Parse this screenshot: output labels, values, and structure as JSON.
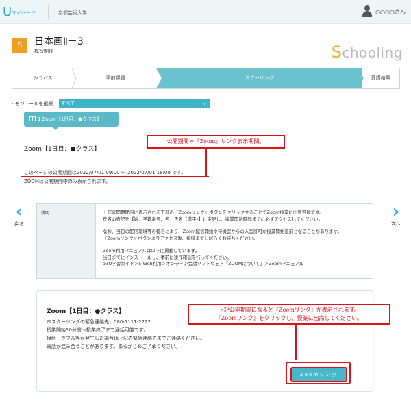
{
  "topbar": {
    "logo": "U",
    "mypage": "マイページ",
    "university": "京都芸術大学",
    "user_name": "○○○○さん"
  },
  "course": {
    "badge": "S",
    "title": "日本画Ⅱ－3",
    "subtitle": "模写制作",
    "brand_initial": "S",
    "brand_rest": "chooling"
  },
  "tabs": [
    {
      "label": "シラバス"
    },
    {
      "label": "事前課題"
    },
    {
      "label": "スクーリング"
    },
    {
      "label": "受講結果"
    }
  ],
  "module": {
    "label": "- モジュールを選択",
    "selected": "すべて"
  },
  "zoom_tab": {
    "label": "1 Zoom【1日目：●クラス】"
  },
  "section": {
    "title": "Zoom【1日目：●クラス】",
    "period": "このページの公開期間は2022/07/01 09:00 ～ 2022/07/01 18:00 です。",
    "period_note": "ZOOMは公開期間中のみ表示されます。"
  },
  "callouts": {
    "period": "公開期間＝『Zoom』リンク表示期間。",
    "zoom_line1": "上記公開期間になると『Zoomリンク』が表示されます。",
    "zoom_line2": "『Zoomリンク』をクリックし、授業に出席してください。"
  },
  "nav": {
    "prev": "戻る",
    "next": "次へ"
  },
  "description": {
    "head": "説明",
    "p1_l1": "上記公開期間内に表示される下部の『Zoomリンク』ボタンをクリックすることでZoom授業に出席可能です。",
    "p1_l2": "氏名の表記を【姓：学籍番号、名：氏名（漢字）】に変更し、授業開始時間までに必ずアクセスしてください。",
    "p2_l1": "なお、当日の配信環境等の都合により、Zoom配信開始や待機室からの入室許可が授業開始直前となることがあります。",
    "p2_l2": "『Zoomリンク』ボタンよりアクセス後、接続までしばらくお待ちください。",
    "p3_l1": "Zoom利用マニュアルは以下に掲載しています。",
    "p3_l2": "当日までにインストールし、事前に操作確認を行ってください。",
    "p3_l3": "airU学習ガイド＞5.Web利用＞オンライン会議ソフトウェア「ZOOMについて」＞Zoomマニュアル"
  },
  "card": {
    "title": "Zoom【1日目：●クラス】",
    "line1": "本スクーリングの緊急連絡先：080-1111-2222",
    "line2": "授業開始30分前～授業終了まで通話可能です。",
    "line3": "接続トラブル等が発生した場合は上記の緊急連絡先までご連絡ください。",
    "line4": "電話が混み合うことがあります。あらかじめご了承ください。",
    "button": "Zoomリンク"
  },
  "colors": {
    "accent": "#3fb3c8",
    "tab_active": "#6ac2cf",
    "badge": "#f0a020",
    "callout_red": "#d9131b"
  }
}
